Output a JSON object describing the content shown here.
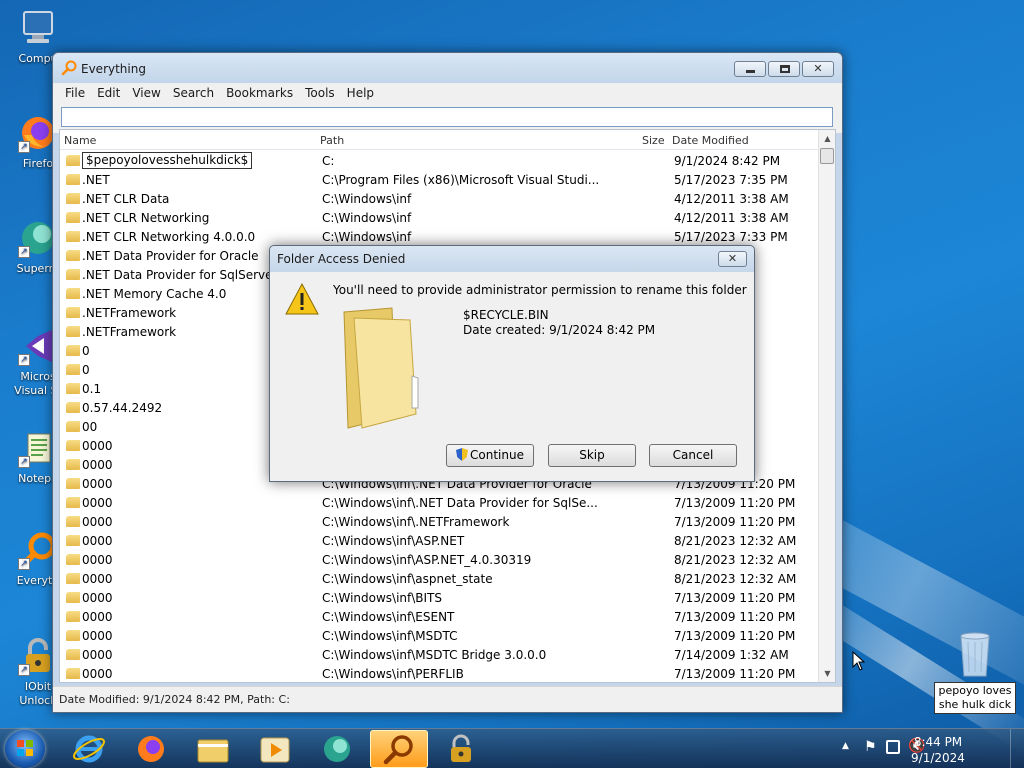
{
  "desktop": {
    "icons": [
      {
        "label": "Compu",
        "icon": "computer-icon"
      },
      {
        "label": "Firefo",
        "icon": "firefox-icon"
      },
      {
        "label": "Superm",
        "icon": "supermium-icon"
      },
      {
        "label": "Micros",
        "label2": "Visual St",
        "icon": "visual-studio-icon"
      },
      {
        "label": "Notepa",
        "icon": "notepad-icon"
      },
      {
        "label": "Everyth",
        "icon": "everything-icon"
      },
      {
        "label": "IObit",
        "label2": "Unlock",
        "icon": "iobit-unlocker-icon"
      }
    ],
    "recycle_bin": {
      "label_line1": "pepoyo loves",
      "label_line2": "she hulk dick"
    }
  },
  "window": {
    "title": "Everything",
    "menu": [
      "File",
      "Edit",
      "View",
      "Search",
      "Bookmarks",
      "Tools",
      "Help"
    ],
    "search_value": "",
    "columns": {
      "name": "Name",
      "path": "Path",
      "size": "Size",
      "date": "Date Modified"
    },
    "rows": [
      {
        "name": "$pepoyolovesshehulkdick$",
        "path": "C:",
        "date": "9/1/2024 8:42 PM",
        "editing": true
      },
      {
        "name": ".NET",
        "path": "C:\\Program Files (x86)\\Microsoft Visual Studi...",
        "date": "5/17/2023 7:35 PM"
      },
      {
        "name": ".NET CLR Data",
        "path": "C:\\Windows\\inf",
        "date": "4/12/2011 3:38 AM"
      },
      {
        "name": ".NET CLR Networking",
        "path": "C:\\Windows\\inf",
        "date": "4/12/2011 3:38 AM"
      },
      {
        "name": ".NET CLR Networking 4.0.0.0",
        "path": "C:\\Windows\\inf",
        "date": "5/17/2023 7:33 PM"
      },
      {
        "name": ".NET Data Provider for Oracle",
        "path": "",
        "date": "AM"
      },
      {
        "name": ".NET Data Provider for SqlServer",
        "path": "",
        "date": "AM"
      },
      {
        "name": ".NET Memory Cache 4.0",
        "path": "",
        "date": "PM"
      },
      {
        "name": ".NETFramework",
        "path": "",
        "date": "PM"
      },
      {
        "name": ".NETFramework",
        "path": "",
        "date": "AM"
      },
      {
        "name": "0",
        "path": "",
        "date": "PM"
      },
      {
        "name": "0",
        "path": "",
        "date": "PM"
      },
      {
        "name": "0.1",
        "path": "",
        "date": "PM"
      },
      {
        "name": "0.57.44.2492",
        "path": "",
        "date": "PM"
      },
      {
        "name": "00",
        "path": "",
        "date": "M"
      },
      {
        "name": "0000",
        "path": "",
        "date": "PM"
      },
      {
        "name": "0000",
        "path": "",
        "date": "PM"
      },
      {
        "name": "0000",
        "path": "C:\\Windows\\inf\\.NET Data Provider for Oracle",
        "date": "7/13/2009 11:20 PM"
      },
      {
        "name": "0000",
        "path": "C:\\Windows\\inf\\.NET Data Provider for SqlSe...",
        "date": "7/13/2009 11:20 PM"
      },
      {
        "name": "0000",
        "path": "C:\\Windows\\inf\\.NETFramework",
        "date": "7/13/2009 11:20 PM"
      },
      {
        "name": "0000",
        "path": "C:\\Windows\\inf\\ASP.NET",
        "date": "8/21/2023 12:32 AM"
      },
      {
        "name": "0000",
        "path": "C:\\Windows\\inf\\ASP.NET_4.0.30319",
        "date": "8/21/2023 12:32 AM"
      },
      {
        "name": "0000",
        "path": "C:\\Windows\\inf\\aspnet_state",
        "date": "8/21/2023 12:32 AM"
      },
      {
        "name": "0000",
        "path": "C:\\Windows\\inf\\BITS",
        "date": "7/13/2009 11:20 PM"
      },
      {
        "name": "0000",
        "path": "C:\\Windows\\inf\\ESENT",
        "date": "7/13/2009 11:20 PM"
      },
      {
        "name": "0000",
        "path": "C:\\Windows\\inf\\MSDTC",
        "date": "7/13/2009 11:20 PM"
      },
      {
        "name": "0000",
        "path": "C:\\Windows\\inf\\MSDTC Bridge 3.0.0.0",
        "date": "7/14/2009 1:32 AM"
      },
      {
        "name": "0000",
        "path": "C:\\Windows\\inf\\PERFLIB",
        "date": "7/13/2009 11:20 PM"
      }
    ],
    "status": "Date Modified: 9/1/2024 8:42 PM, Path: C:"
  },
  "dialog": {
    "title": "Folder Access Denied",
    "message": "You'll need to provide administrator permission to rename this folder",
    "file_name": "$RECYCLE.BIN",
    "date_created": "Date created: 9/1/2024 8:42 PM",
    "buttons": {
      "continue": "Continue",
      "skip": "Skip",
      "cancel": "Cancel"
    }
  },
  "taskbar": {
    "apps": [
      "internet-explorer-icon",
      "firefox-icon",
      "file-explorer-icon",
      "media-player-icon",
      "supermium-icon",
      "everything-icon",
      "iobit-unlocker-icon"
    ],
    "active_app": "everything-icon",
    "clock_time": "8:44 PM",
    "clock_date": "9/1/2024"
  }
}
